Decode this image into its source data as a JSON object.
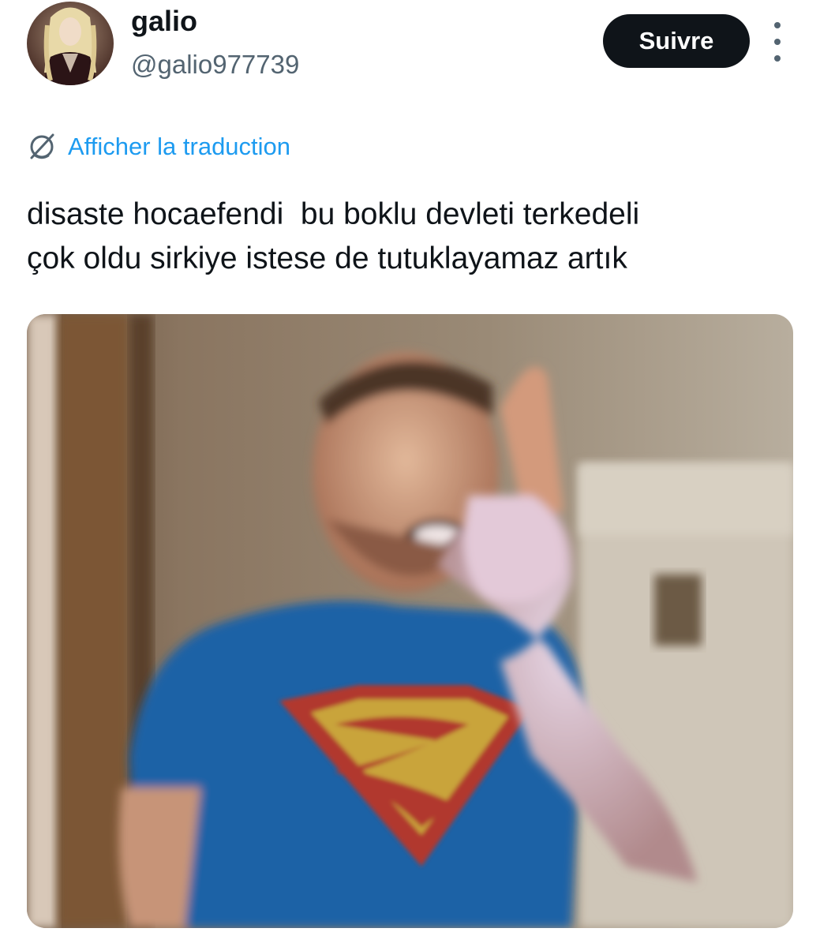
{
  "author": {
    "display_name": "galio",
    "handle": "@galio977739",
    "avatar_icon": "vampire-portrait-avatar"
  },
  "actions": {
    "follow_label": "Suivre",
    "more_icon": "more-vertical-icon"
  },
  "translate": {
    "icon": "globe-icon",
    "label": "Afficher la traduction"
  },
  "tweet": {
    "text": "disaste hocaefendi  bu boklu devleti terkedeli\nçok oldu sirkiye istese de tutuklayamaz artık"
  },
  "media": {
    "icon": "photo-man-in-superman-shirt-pointing"
  },
  "colors": {
    "text": "#0f1419",
    "secondary": "#536471",
    "link": "#1d9bf0",
    "button_bg": "#0f1419",
    "button_text": "#ffffff"
  }
}
